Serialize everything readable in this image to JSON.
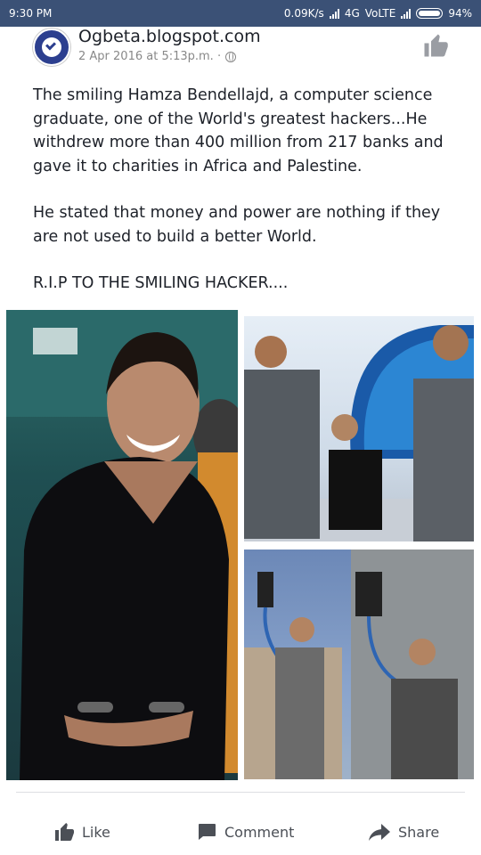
{
  "status_bar": {
    "time": "9:30 PM",
    "speed": "0.09K/s",
    "network": "4G",
    "volte": "VoLTE",
    "battery": "94%"
  },
  "post": {
    "page_name": "Ogbeta.blogspot.com",
    "timestamp": "2 Apr 2016 at 5:13p.m. ·",
    "paragraphs": [
      "The smiling Hamza Bendellajd, a computer science graduate, one of the World's greatest hackers...He withdrew more than 400 million from 217 banks and gave it to charities in Africa and Palestine.",
      "He stated that money and power are nothing if they are not used to build a better World.",
      "R.I.P TO THE SMILING HACKER...."
    ]
  },
  "actions": {
    "like": "Like",
    "comment": "Comment",
    "share": "Share"
  },
  "icons": {
    "verified": "check-circle-icon",
    "privacy": "globe-icon",
    "page_like": "thumbs-up-icon",
    "like": "thumbs-up-icon",
    "comment": "comment-icon",
    "share": "share-arrow-icon"
  },
  "colors": {
    "status_bar": "#3b5176",
    "avatar": "#2c3f8f",
    "text": "#1d2129",
    "muted": "#888888",
    "action": "#4b4f56"
  }
}
